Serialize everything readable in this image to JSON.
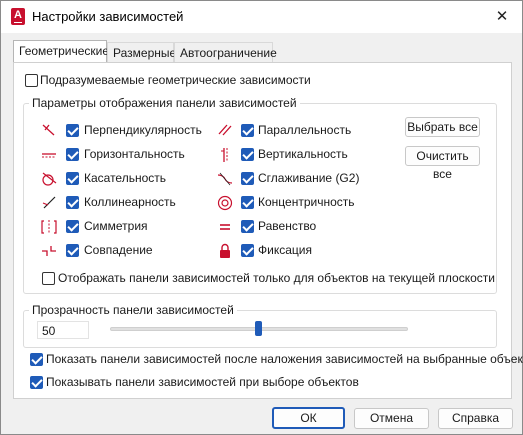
{
  "window": {
    "title": "Настройки зависимостей"
  },
  "tabs": [
    {
      "label": "Геометрические",
      "active": true
    },
    {
      "label": "Размерные",
      "active": false
    },
    {
      "label": "Автоограничение",
      "active": false
    }
  ],
  "geometric": {
    "infer_label": "Подразумеваемые геометрические зависимости",
    "infer_checked": false,
    "display_group_title": "Параметры отображения панели зависимостей",
    "constraints_left": [
      {
        "label": "Перпендикулярность",
        "icon": "perpendicular-icon",
        "checked": true
      },
      {
        "label": "Горизонтальность",
        "icon": "horizontal-icon",
        "checked": true
      },
      {
        "label": "Касательность",
        "icon": "tangent-icon",
        "checked": true
      },
      {
        "label": "Коллинеарность",
        "icon": "collinear-icon",
        "checked": true
      },
      {
        "label": "Симметрия",
        "icon": "symmetric-icon",
        "checked": true
      },
      {
        "label": "Совпадение",
        "icon": "coincident-icon",
        "checked": true
      }
    ],
    "constraints_right": [
      {
        "label": "Параллельность",
        "icon": "parallel-icon",
        "checked": true
      },
      {
        "label": "Вертикальность",
        "icon": "vertical-icon",
        "checked": true
      },
      {
        "label": "Сглаживание (G2)",
        "icon": "smooth-icon",
        "checked": true
      },
      {
        "label": "Концентричность",
        "icon": "concentric-icon",
        "checked": true
      },
      {
        "label": "Равенство",
        "icon": "equal-icon",
        "checked": true
      },
      {
        "label": "Фиксация",
        "icon": "lock-icon",
        "checked": true
      }
    ],
    "select_all_label": "Выбрать все",
    "clear_all_label": "Очистить все",
    "current_plane_label": "Отображать панели зависимостей только для объектов на текущей плоскости",
    "current_plane_checked": false,
    "transparency_title": "Прозрачность панели зависимостей",
    "transparency_value": "50",
    "show_after_apply_label": "Показать панели зависимостей после наложения зависимостей на выбранные объекты",
    "show_after_apply_checked": true,
    "show_on_select_label": "Показывать панели зависимостей при выборе объектов",
    "show_on_select_checked": true
  },
  "footer": {
    "ok_label": "ОК",
    "cancel_label": "Отмена",
    "help_label": "Справка"
  },
  "colors": {
    "accent": "#1f5bb8",
    "icon_red": "#c8102e"
  }
}
